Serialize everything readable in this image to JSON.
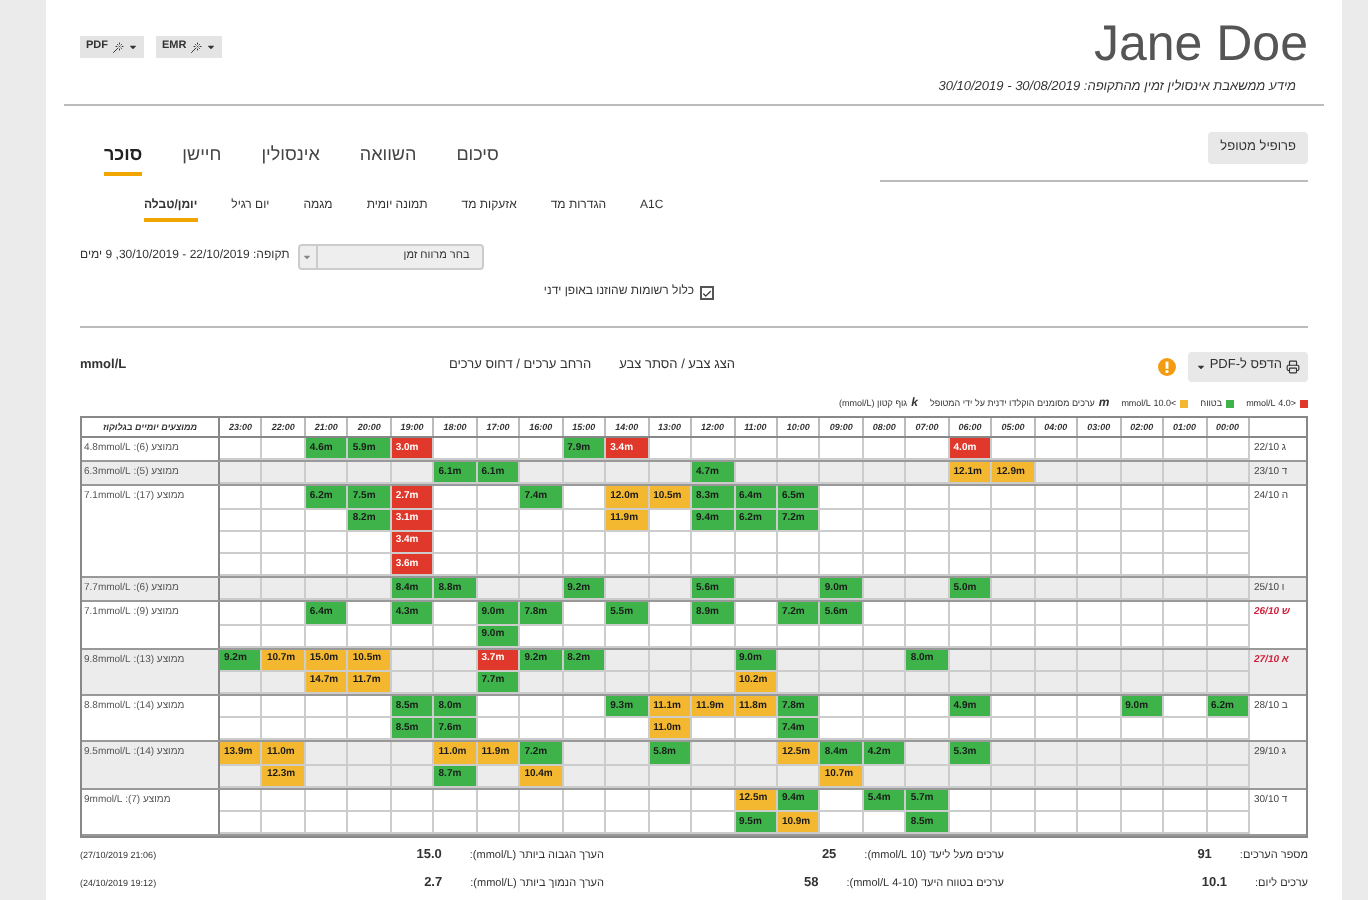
{
  "header": {
    "name": "Jane Doe",
    "subtitle": "מידע ממשאבת אינסולין זמין מהתקופה: 30/08/2019 - 30/10/2019",
    "export_buttons": [
      {
        "label": "PDF"
      },
      {
        "label": "EMR"
      }
    ]
  },
  "profile_button": "פרופיל מטופל",
  "tabs": [
    {
      "label": "סיכום",
      "selected": false
    },
    {
      "label": "השוואה",
      "selected": false
    },
    {
      "label": "אינסולין",
      "selected": false
    },
    {
      "label": "חיישן",
      "selected": false
    },
    {
      "label": "סוכר",
      "selected": true
    }
  ],
  "subtabs": [
    {
      "label": "A1C",
      "selected": false
    },
    {
      "label": "הגדרות מד",
      "selected": false
    },
    {
      "label": "אזעקות מד",
      "selected": false
    },
    {
      "label": "תמונה יומית",
      "selected": false
    },
    {
      "label": "מגמה",
      "selected": false
    },
    {
      "label": "יום רגיל",
      "selected": false
    },
    {
      "label": "יומן/טבלה",
      "selected": true
    }
  ],
  "period": {
    "select_label": "בחר מרווח זמן",
    "text": "תקופה: 22/10/2019 - 30/10/2019, 9 ימים"
  },
  "manual_checkbox": {
    "label": "כלול רשומות שהוזנו באופן ידני",
    "checked": true
  },
  "toolbar": {
    "print_button": "הדפס ל-PDF",
    "links": [
      "הצג צבע / הסתר צבע",
      "הרחב ערכים / דחוס ערכים"
    ],
    "unit": "mmol/L"
  },
  "manual_note": {
    "symbol": "m",
    "label": "ערכים מסומנים הוקלדו ידנית על ידי המטופל"
  },
  "ketone_note": {
    "symbol": "k",
    "label": "גוף קטון (mmol/L)"
  },
  "legend": [
    {
      "kind": "swatch",
      "color": "#f4b730",
      "label": ">10.0 mmol/L"
    },
    {
      "kind": "swatch",
      "color": "#3db34a",
      "label": "בטווח"
    },
    {
      "kind": "swatch",
      "color": "#e0392b",
      "label": "<4.0 mmol/L"
    }
  ],
  "table": {
    "summary_header": "ממוצעים יומיים בגלוקוז",
    "hours": [
      "23:00",
      "22:00",
      "21:00",
      "20:00",
      "19:00",
      "18:00",
      "17:00",
      "16:00",
      "15:00",
      "14:00",
      "13:00",
      "12:00",
      "11:00",
      "10:00",
      "09:00",
      "08:00",
      "07:00",
      "06:00",
      "05:00",
      "04:00",
      "03:00",
      "02:00",
      "01:00",
      "00:00"
    ],
    "days": [
      {
        "date": "22/10 ג",
        "weekend": false,
        "summary": "ממוצע (6): 4.8mmol/L",
        "rows": [
          [
            null,
            null,
            {
              "value": "4.6m",
              "kind": "normal"
            },
            {
              "value": "5.9m",
              "kind": "normal"
            },
            {
              "value": "3.0m",
              "kind": "low"
            },
            null,
            null,
            null,
            {
              "value": "7.9m",
              "kind": "normal"
            },
            {
              "value": "3.4m",
              "kind": "low"
            },
            null,
            null,
            null,
            null,
            null,
            null,
            null,
            {
              "value": "4.0m",
              "kind": "low"
            },
            null,
            null,
            null,
            null,
            null,
            null
          ]
        ]
      },
      {
        "date": "23/10 ד",
        "weekend": false,
        "summary": "ממוצע (5): 6.3mmol/L",
        "rows": [
          [
            null,
            null,
            null,
            null,
            null,
            {
              "value": "6.1m",
              "kind": "normal"
            },
            {
              "value": "6.1m",
              "kind": "normal"
            },
            null,
            null,
            null,
            null,
            {
              "value": "4.7m",
              "kind": "normal"
            },
            null,
            null,
            null,
            null,
            null,
            {
              "value": "12.1m",
              "kind": "high"
            },
            {
              "value": "12.9m",
              "kind": "high"
            },
            null,
            null,
            null,
            null,
            null
          ]
        ]
      },
      {
        "date": "24/10 ה",
        "weekend": false,
        "summary": "ממוצע (17): 7.1mmol/L",
        "rows": [
          [
            null,
            null,
            {
              "value": "6.2m",
              "kind": "normal"
            },
            {
              "value": "7.5m",
              "kind": "normal"
            },
            {
              "value": "2.7m",
              "kind": "low"
            },
            null,
            null,
            {
              "value": "7.4m",
              "kind": "normal"
            },
            null,
            {
              "value": "12.0m",
              "kind": "high"
            },
            {
              "value": "10.5m",
              "kind": "high"
            },
            {
              "value": "8.3m",
              "kind": "normal"
            },
            {
              "value": "6.4m",
              "kind": "normal"
            },
            {
              "value": "6.5m",
              "kind": "normal"
            },
            null,
            null,
            null,
            null,
            null,
            null,
            null,
            null,
            null,
            null
          ],
          [
            null,
            null,
            null,
            {
              "value": "8.2m",
              "kind": "normal"
            },
            {
              "value": "3.1m",
              "kind": "low"
            },
            null,
            null,
            null,
            null,
            {
              "value": "11.9m",
              "kind": "high"
            },
            null,
            {
              "value": "9.4m",
              "kind": "normal"
            },
            {
              "value": "6.2m",
              "kind": "normal"
            },
            {
              "value": "7.2m",
              "kind": "normal"
            },
            null,
            null,
            null,
            null,
            null,
            null,
            null,
            null,
            null,
            null
          ],
          [
            null,
            null,
            null,
            null,
            {
              "value": "3.4m",
              "kind": "low"
            },
            null,
            null,
            null,
            null,
            null,
            null,
            null,
            null,
            null,
            null,
            null,
            null,
            null,
            null,
            null,
            null,
            null,
            null,
            null
          ],
          [
            null,
            null,
            null,
            null,
            {
              "value": "3.6m",
              "kind": "low"
            },
            null,
            null,
            null,
            null,
            null,
            null,
            null,
            null,
            null,
            null,
            null,
            null,
            null,
            null,
            null,
            null,
            null,
            null,
            null
          ]
        ]
      },
      {
        "date": "25/10 ו",
        "weekend": false,
        "summary": "ממוצע (6): 7.7mmol/L",
        "rows": [
          [
            null,
            null,
            null,
            null,
            {
              "value": "8.4m",
              "kind": "normal"
            },
            {
              "value": "8.8m",
              "kind": "normal"
            },
            null,
            null,
            {
              "value": "9.2m",
              "kind": "normal"
            },
            null,
            null,
            {
              "value": "5.6m",
              "kind": "normal"
            },
            null,
            null,
            {
              "value": "9.0m",
              "kind": "normal"
            },
            null,
            null,
            {
              "value": "5.0m",
              "kind": "normal"
            },
            null,
            null,
            null,
            null,
            null,
            null
          ]
        ]
      },
      {
        "date": "26/10 ש",
        "weekend": true,
        "summary": "ממוצע (9): 7.1mmol/L",
        "rows": [
          [
            null,
            null,
            {
              "value": "6.4m",
              "kind": "normal"
            },
            null,
            {
              "value": "4.3m",
              "kind": "normal"
            },
            null,
            {
              "value": "9.0m",
              "kind": "normal"
            },
            {
              "value": "7.8m",
              "kind": "normal"
            },
            null,
            {
              "value": "5.5m",
              "kind": "normal"
            },
            null,
            {
              "value": "8.9m",
              "kind": "normal"
            },
            null,
            {
              "value": "7.2m",
              "kind": "normal"
            },
            {
              "value": "5.6m",
              "kind": "normal"
            },
            null,
            null,
            null,
            null,
            null,
            null,
            null,
            null,
            null
          ],
          [
            null,
            null,
            null,
            null,
            null,
            null,
            {
              "value": "9.0m",
              "kind": "normal"
            },
            null,
            null,
            null,
            null,
            null,
            null,
            null,
            null,
            null,
            null,
            null,
            null,
            null,
            null,
            null,
            null,
            null
          ]
        ]
      },
      {
        "date": "27/10 א",
        "weekend": true,
        "summary": "ממוצע (13): 9.8mmol/L",
        "rows": [
          [
            {
              "value": "9.2m",
              "kind": "normal"
            },
            {
              "value": "10.7m",
              "kind": "high"
            },
            {
              "value": "15.0m",
              "kind": "high"
            },
            {
              "value": "10.5m",
              "kind": "high"
            },
            null,
            null,
            {
              "value": "3.7m",
              "kind": "low"
            },
            {
              "value": "9.2m",
              "kind": "normal"
            },
            {
              "value": "8.2m",
              "kind": "normal"
            },
            null,
            null,
            null,
            {
              "value": "9.0m",
              "kind": "normal"
            },
            null,
            null,
            null,
            {
              "value": "8.0m",
              "kind": "normal"
            },
            null,
            null,
            null,
            null,
            null,
            null,
            null
          ],
          [
            null,
            null,
            {
              "value": "14.7m",
              "kind": "high"
            },
            {
              "value": "11.7m",
              "kind": "high"
            },
            null,
            null,
            {
              "value": "7.7m",
              "kind": "normal"
            },
            null,
            null,
            null,
            null,
            null,
            {
              "value": "10.2m",
              "kind": "high"
            },
            null,
            null,
            null,
            null,
            null,
            null,
            null,
            null,
            null,
            null,
            null
          ]
        ]
      },
      {
        "date": "28/10 ב",
        "weekend": false,
        "summary": "ממוצע (14): 8.8mmol/L",
        "rows": [
          [
            null,
            null,
            null,
            null,
            {
              "value": "8.5m",
              "kind": "normal"
            },
            {
              "value": "8.0m",
              "kind": "normal"
            },
            null,
            null,
            null,
            {
              "value": "9.3m",
              "kind": "normal"
            },
            {
              "value": "11.1m",
              "kind": "high"
            },
            {
              "value": "11.9m",
              "kind": "high"
            },
            {
              "value": "11.8m",
              "kind": "high"
            },
            {
              "value": "7.8m",
              "kind": "normal"
            },
            null,
            null,
            null,
            {
              "value": "4.9m",
              "kind": "normal"
            },
            null,
            null,
            null,
            {
              "value": "9.0m",
              "kind": "normal"
            },
            null,
            {
              "value": "6.2m",
              "kind": "normal"
            }
          ],
          [
            null,
            null,
            null,
            null,
            {
              "value": "8.5m",
              "kind": "normal"
            },
            {
              "value": "7.6m",
              "kind": "normal"
            },
            null,
            null,
            null,
            null,
            {
              "value": "11.0m",
              "kind": "high"
            },
            null,
            null,
            {
              "value": "7.4m",
              "kind": "normal"
            },
            null,
            null,
            null,
            null,
            null,
            null,
            null,
            null,
            null,
            null
          ]
        ]
      },
      {
        "date": "29/10 ג",
        "weekend": false,
        "summary": "ממוצע (14): 9.5mmol/L",
        "rows": [
          [
            {
              "value": "13.9m",
              "kind": "high"
            },
            {
              "value": "11.0m",
              "kind": "high"
            },
            null,
            null,
            null,
            {
              "value": "11.0m",
              "kind": "high"
            },
            {
              "value": "11.9m",
              "kind": "high"
            },
            {
              "value": "7.2m",
              "kind": "normal"
            },
            null,
            null,
            {
              "value": "5.8m",
              "kind": "normal"
            },
            null,
            null,
            {
              "value": "12.5m",
              "kind": "high"
            },
            {
              "value": "8.4m",
              "kind": "normal"
            },
            {
              "value": "4.2m",
              "kind": "normal"
            },
            null,
            {
              "value": "5.3m",
              "kind": "normal"
            },
            null,
            null,
            null,
            null,
            null,
            null
          ],
          [
            null,
            {
              "value": "12.3m",
              "kind": "high"
            },
            null,
            null,
            null,
            {
              "value": "8.7m",
              "kind": "normal"
            },
            null,
            {
              "value": "10.4m",
              "kind": "high"
            },
            null,
            null,
            null,
            null,
            null,
            null,
            {
              "value": "10.7m",
              "kind": "high"
            },
            null,
            null,
            null,
            null,
            null,
            null,
            null,
            null,
            null
          ]
        ]
      },
      {
        "date": "30/10 ד",
        "weekend": false,
        "summary": "ממוצע (7): 9mmol/L",
        "rows": [
          [
            null,
            null,
            null,
            null,
            null,
            null,
            null,
            null,
            null,
            null,
            null,
            null,
            {
              "value": "12.5m",
              "kind": "high"
            },
            {
              "value": "9.4m",
              "kind": "normal"
            },
            null,
            {
              "value": "5.4m",
              "kind": "normal"
            },
            {
              "value": "5.7m",
              "kind": "normal"
            },
            null,
            null,
            null,
            null,
            null,
            null,
            null
          ],
          [
            null,
            null,
            null,
            null,
            null,
            null,
            null,
            null,
            null,
            null,
            null,
            null,
            {
              "value": "9.5m",
              "kind": "normal"
            },
            {
              "value": "10.9m",
              "kind": "high"
            },
            null,
            null,
            {
              "value": "8.5m",
              "kind": "normal"
            },
            null,
            null,
            null,
            null,
            null,
            null,
            null
          ]
        ]
      }
    ]
  },
  "stats": {
    "reading_count": {
      "label": "מספר הערכים:",
      "value": "91"
    },
    "above_target": {
      "label": "ערכים מעל ליעד (10 mmol/L):",
      "value": "25"
    },
    "highest": {
      "label": "הערך הגבוה ביותר (mmol/L):",
      "value": "15.0",
      "note": "(21:06 27/10/2019)"
    },
    "per_day": {
      "label": "ערכים ליום:",
      "value": "10.1"
    },
    "in_range": {
      "label": "ערכים בטווח היעד (4-10 mmol/L):",
      "value": "58"
    },
    "lowest": {
      "label": "הערך הנמוך ביותר (mmol/L):",
      "value": "2.7",
      "note": "(19:12 24/10/2019)"
    }
  }
}
